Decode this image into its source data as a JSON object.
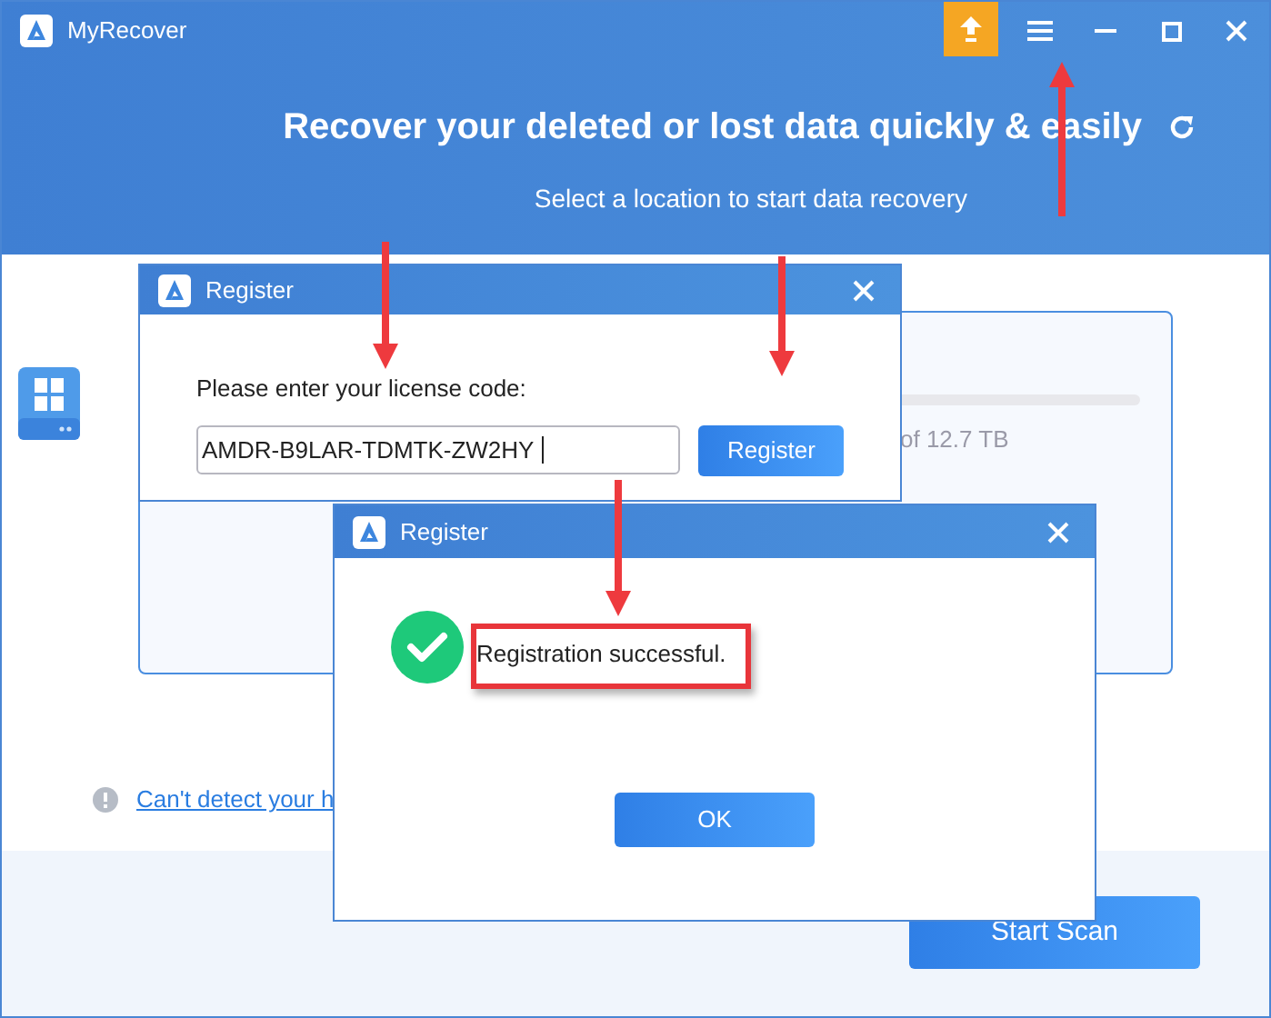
{
  "app": {
    "title": "MyRecover"
  },
  "header": {
    "heading": "Recover your deleted or lost data quickly & easily",
    "subheading": "Select a location to start data recovery"
  },
  "drive": {
    "capacity": "of 12.7 TB"
  },
  "help_link": "Can't detect your h",
  "start_button": "Start Scan",
  "register_dialog": {
    "title": "Register",
    "prompt": "Please enter your license code:",
    "license_code": "AMDR-B9LAR-TDMTK-ZW2HY",
    "button": "Register"
  },
  "success_dialog": {
    "title": "Register",
    "message": "Registration successful.",
    "button": "OK"
  },
  "annotations": [
    {
      "kind": "arrow-down"
    },
    {
      "kind": "arrow-down"
    },
    {
      "kind": "arrow-down"
    },
    {
      "kind": "arrow-up"
    },
    {
      "kind": "box"
    }
  ]
}
